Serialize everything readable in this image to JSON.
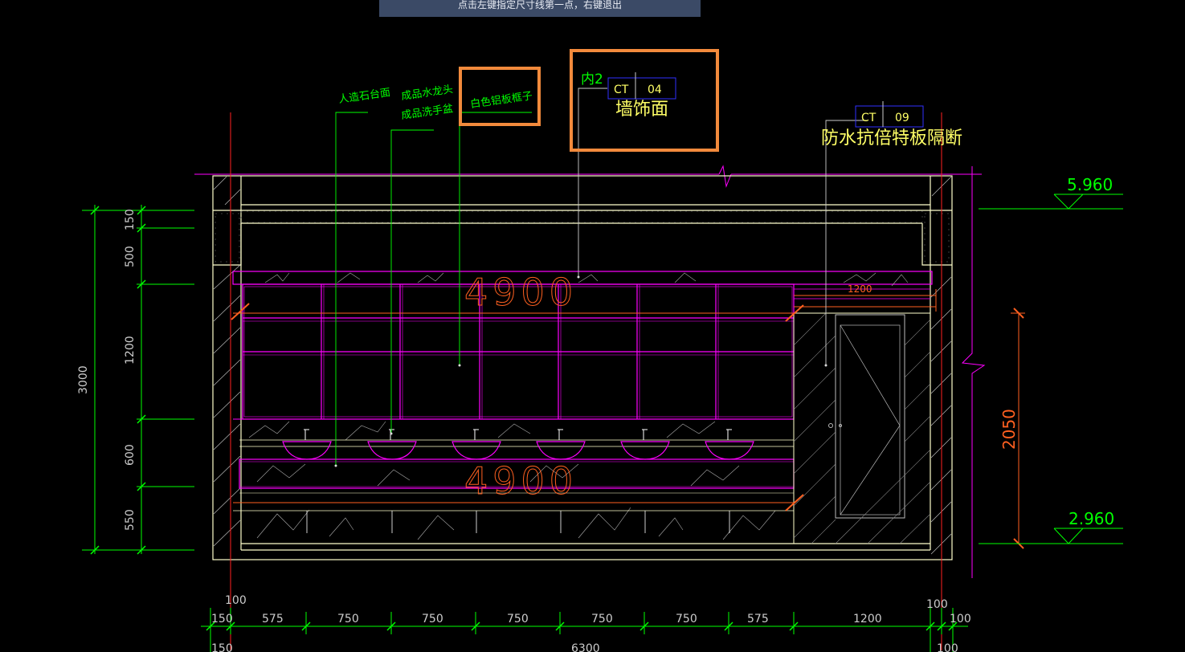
{
  "command_prompt": "点击左键指定尺寸线第一点，右键退出",
  "labels": {
    "stone_top": "人造石台面",
    "faucet": "成品水龙头",
    "basin": "成品洗手盆",
    "aluminum_frame": "白色铝板框子",
    "nei2": "内2",
    "ct1_code": "CT",
    "ct1_num": "04",
    "wall_finish": "墙饰面",
    "ct2_code": "CT",
    "ct2_num": "09",
    "partition": "防水抗倍特板隔断"
  },
  "elevations": {
    "top": "5.960",
    "bottom": "2.960"
  },
  "vertical_dims": {
    "segments": [
      "150",
      "500",
      "1200",
      "600",
      "550"
    ],
    "total": "3000",
    "door_height": "2050"
  },
  "horizontal_dims": {
    "left_edge": "100",
    "right_edge": "100",
    "segments": [
      "150",
      "575",
      "750",
      "750",
      "750",
      "750",
      "750",
      "575",
      "1200",
      "100"
    ],
    "bottom_left": "150",
    "total": "6300",
    "bottom_right": "100"
  },
  "width_labels": {
    "mirror_width": "4900",
    "counter_width": "4900",
    "door_width": "1200"
  },
  "colors": {
    "background": "#000000",
    "dimension": "#00ff00",
    "outline": "#ffffcc",
    "fixture": "#ff00ff",
    "axis": "#ff2020",
    "annotation": "#ffff66",
    "highlight": "#f28a3c",
    "tag_box": "#3030ff",
    "hatch": "#bbbbbb"
  }
}
